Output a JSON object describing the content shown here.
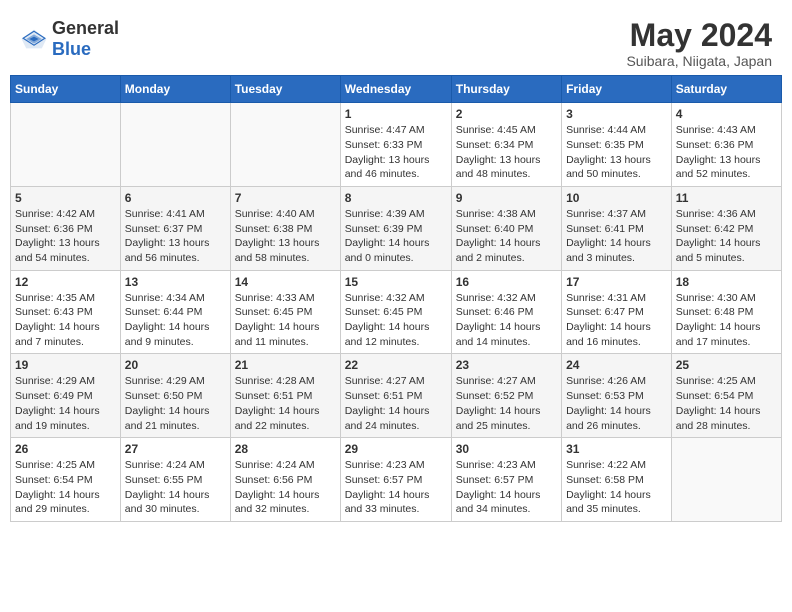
{
  "header": {
    "logo_general": "General",
    "logo_blue": "Blue",
    "month_year": "May 2024",
    "location": "Suibara, Niigata, Japan"
  },
  "weekdays": [
    "Sunday",
    "Monday",
    "Tuesday",
    "Wednesday",
    "Thursday",
    "Friday",
    "Saturday"
  ],
  "weeks": [
    [
      {
        "day": "",
        "sunrise": "",
        "sunset": "",
        "daylight": ""
      },
      {
        "day": "",
        "sunrise": "",
        "sunset": "",
        "daylight": ""
      },
      {
        "day": "",
        "sunrise": "",
        "sunset": "",
        "daylight": ""
      },
      {
        "day": "1",
        "sunrise": "Sunrise: 4:47 AM",
        "sunset": "Sunset: 6:33 PM",
        "daylight": "Daylight: 13 hours and 46 minutes."
      },
      {
        "day": "2",
        "sunrise": "Sunrise: 4:45 AM",
        "sunset": "Sunset: 6:34 PM",
        "daylight": "Daylight: 13 hours and 48 minutes."
      },
      {
        "day": "3",
        "sunrise": "Sunrise: 4:44 AM",
        "sunset": "Sunset: 6:35 PM",
        "daylight": "Daylight: 13 hours and 50 minutes."
      },
      {
        "day": "4",
        "sunrise": "Sunrise: 4:43 AM",
        "sunset": "Sunset: 6:36 PM",
        "daylight": "Daylight: 13 hours and 52 minutes."
      }
    ],
    [
      {
        "day": "5",
        "sunrise": "Sunrise: 4:42 AM",
        "sunset": "Sunset: 6:36 PM",
        "daylight": "Daylight: 13 hours and 54 minutes."
      },
      {
        "day": "6",
        "sunrise": "Sunrise: 4:41 AM",
        "sunset": "Sunset: 6:37 PM",
        "daylight": "Daylight: 13 hours and 56 minutes."
      },
      {
        "day": "7",
        "sunrise": "Sunrise: 4:40 AM",
        "sunset": "Sunset: 6:38 PM",
        "daylight": "Daylight: 13 hours and 58 minutes."
      },
      {
        "day": "8",
        "sunrise": "Sunrise: 4:39 AM",
        "sunset": "Sunset: 6:39 PM",
        "daylight": "Daylight: 14 hours and 0 minutes."
      },
      {
        "day": "9",
        "sunrise": "Sunrise: 4:38 AM",
        "sunset": "Sunset: 6:40 PM",
        "daylight": "Daylight: 14 hours and 2 minutes."
      },
      {
        "day": "10",
        "sunrise": "Sunrise: 4:37 AM",
        "sunset": "Sunset: 6:41 PM",
        "daylight": "Daylight: 14 hours and 3 minutes."
      },
      {
        "day": "11",
        "sunrise": "Sunrise: 4:36 AM",
        "sunset": "Sunset: 6:42 PM",
        "daylight": "Daylight: 14 hours and 5 minutes."
      }
    ],
    [
      {
        "day": "12",
        "sunrise": "Sunrise: 4:35 AM",
        "sunset": "Sunset: 6:43 PM",
        "daylight": "Daylight: 14 hours and 7 minutes."
      },
      {
        "day": "13",
        "sunrise": "Sunrise: 4:34 AM",
        "sunset": "Sunset: 6:44 PM",
        "daylight": "Daylight: 14 hours and 9 minutes."
      },
      {
        "day": "14",
        "sunrise": "Sunrise: 4:33 AM",
        "sunset": "Sunset: 6:45 PM",
        "daylight": "Daylight: 14 hours and 11 minutes."
      },
      {
        "day": "15",
        "sunrise": "Sunrise: 4:32 AM",
        "sunset": "Sunset: 6:45 PM",
        "daylight": "Daylight: 14 hours and 12 minutes."
      },
      {
        "day": "16",
        "sunrise": "Sunrise: 4:32 AM",
        "sunset": "Sunset: 6:46 PM",
        "daylight": "Daylight: 14 hours and 14 minutes."
      },
      {
        "day": "17",
        "sunrise": "Sunrise: 4:31 AM",
        "sunset": "Sunset: 6:47 PM",
        "daylight": "Daylight: 14 hours and 16 minutes."
      },
      {
        "day": "18",
        "sunrise": "Sunrise: 4:30 AM",
        "sunset": "Sunset: 6:48 PM",
        "daylight": "Daylight: 14 hours and 17 minutes."
      }
    ],
    [
      {
        "day": "19",
        "sunrise": "Sunrise: 4:29 AM",
        "sunset": "Sunset: 6:49 PM",
        "daylight": "Daylight: 14 hours and 19 minutes."
      },
      {
        "day": "20",
        "sunrise": "Sunrise: 4:29 AM",
        "sunset": "Sunset: 6:50 PM",
        "daylight": "Daylight: 14 hours and 21 minutes."
      },
      {
        "day": "21",
        "sunrise": "Sunrise: 4:28 AM",
        "sunset": "Sunset: 6:51 PM",
        "daylight": "Daylight: 14 hours and 22 minutes."
      },
      {
        "day": "22",
        "sunrise": "Sunrise: 4:27 AM",
        "sunset": "Sunset: 6:51 PM",
        "daylight": "Daylight: 14 hours and 24 minutes."
      },
      {
        "day": "23",
        "sunrise": "Sunrise: 4:27 AM",
        "sunset": "Sunset: 6:52 PM",
        "daylight": "Daylight: 14 hours and 25 minutes."
      },
      {
        "day": "24",
        "sunrise": "Sunrise: 4:26 AM",
        "sunset": "Sunset: 6:53 PM",
        "daylight": "Daylight: 14 hours and 26 minutes."
      },
      {
        "day": "25",
        "sunrise": "Sunrise: 4:25 AM",
        "sunset": "Sunset: 6:54 PM",
        "daylight": "Daylight: 14 hours and 28 minutes."
      }
    ],
    [
      {
        "day": "26",
        "sunrise": "Sunrise: 4:25 AM",
        "sunset": "Sunset: 6:54 PM",
        "daylight": "Daylight: 14 hours and 29 minutes."
      },
      {
        "day": "27",
        "sunrise": "Sunrise: 4:24 AM",
        "sunset": "Sunset: 6:55 PM",
        "daylight": "Daylight: 14 hours and 30 minutes."
      },
      {
        "day": "28",
        "sunrise": "Sunrise: 4:24 AM",
        "sunset": "Sunset: 6:56 PM",
        "daylight": "Daylight: 14 hours and 32 minutes."
      },
      {
        "day": "29",
        "sunrise": "Sunrise: 4:23 AM",
        "sunset": "Sunset: 6:57 PM",
        "daylight": "Daylight: 14 hours and 33 minutes."
      },
      {
        "day": "30",
        "sunrise": "Sunrise: 4:23 AM",
        "sunset": "Sunset: 6:57 PM",
        "daylight": "Daylight: 14 hours and 34 minutes."
      },
      {
        "day": "31",
        "sunrise": "Sunrise: 4:22 AM",
        "sunset": "Sunset: 6:58 PM",
        "daylight": "Daylight: 14 hours and 35 minutes."
      },
      {
        "day": "",
        "sunrise": "",
        "sunset": "",
        "daylight": ""
      }
    ]
  ]
}
